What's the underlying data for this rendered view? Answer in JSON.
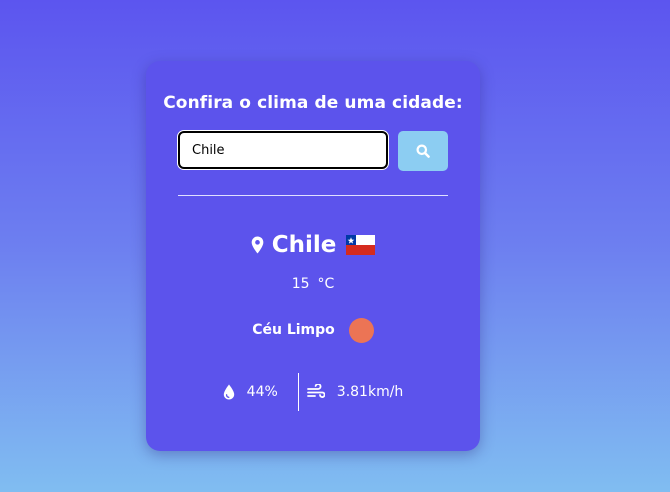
{
  "search": {
    "title": "Confira o clima de uma cidade:",
    "input_value": "Chile",
    "button_icon": "search-icon"
  },
  "weather": {
    "city": "Chile",
    "flag": "chile-flag",
    "temperature": "15",
    "temperature_unit": "°C",
    "description": "Céu Limpo",
    "icon_color": "#ec7455",
    "humidity": "44%",
    "wind": "3.81km/h"
  },
  "colors": {
    "card_background": "#5c53ec",
    "search_button": "#8ccdf2",
    "gradient_top": "#5c55ef",
    "gradient_bottom": "#80bdf1"
  }
}
